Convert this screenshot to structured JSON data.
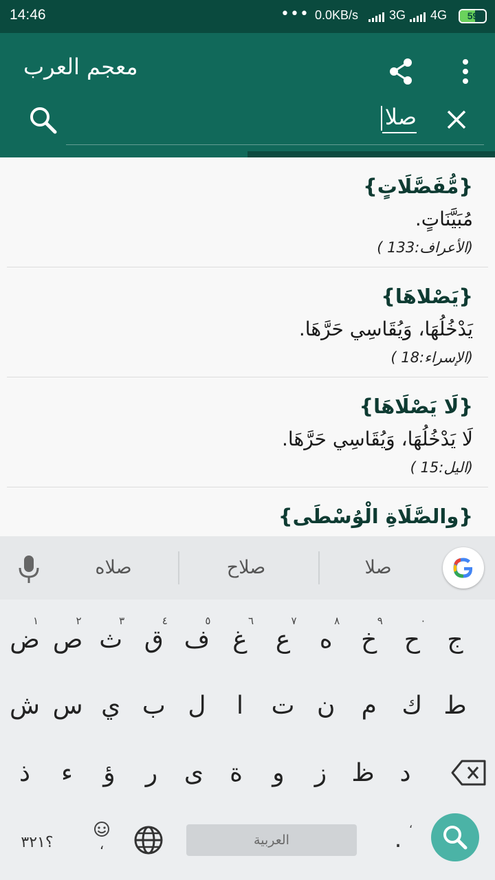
{
  "status_bar": {
    "time": "14:46",
    "dots": "•••",
    "net_speed": "0.0KB/s",
    "network_1": "3G",
    "network_2": "4G",
    "battery": "59",
    "battery_level": 0.59,
    "signal_bars_1": 5,
    "signal_bars_2": 5
  },
  "app_bar": {
    "title": "معجم العرب",
    "search_value": "صلا",
    "icons": [
      "share-icon",
      "more-vert-icon",
      "search-icon",
      "close-icon"
    ]
  },
  "load_progress": 0.5,
  "results": [
    {
      "head": "{مُّفَصَّلَاتٍ}",
      "definition": "مُبَيَّنَاتٍ.",
      "reference": "(الأعراف:133 )"
    },
    {
      "head": "{يَصْلاهَا}",
      "definition": "يَدْخُلُهَا، وَيُقَاسِي حَرَّهَا.",
      "reference": "(الإسراء:18 )"
    },
    {
      "head": "{لَا يَصْلَاهَا}",
      "definition": "لَا يَدْخُلُهَا، وَيُقَاسِي حَرَّهَا.",
      "reference": "(اليل:15 )"
    },
    {
      "head": "{والصَّلَاةِ الْوُسْطَى}",
      "definition": "",
      "reference": ""
    }
  ],
  "suggestions": [
    "صلا",
    "صلاح",
    "صلاه"
  ],
  "keyboard": {
    "row1": [
      {
        "k": "ض",
        "h": "١"
      },
      {
        "k": "ص",
        "h": "٢"
      },
      {
        "k": "ث",
        "h": "٣"
      },
      {
        "k": "ق",
        "h": "٤"
      },
      {
        "k": "ف",
        "h": "٥"
      },
      {
        "k": "غ",
        "h": "٦"
      },
      {
        "k": "ع",
        "h": "٧"
      },
      {
        "k": "ه",
        "h": "٨"
      },
      {
        "k": "خ",
        "h": "٩"
      },
      {
        "k": "ح",
        "h": "٠"
      },
      {
        "k": "ج",
        "h": ""
      }
    ],
    "row2": [
      "ش",
      "س",
      "ي",
      "ب",
      "ل",
      "ا",
      "ت",
      "ن",
      "م",
      "ك",
      "ط"
    ],
    "row3": [
      "ذ",
      "ء",
      "ؤ",
      "ر",
      "ى",
      "ة",
      "و",
      "ز",
      "ظ",
      "د"
    ],
    "symbols_label": "؟٣٢١",
    "space_label": "العربية",
    "period_label": ".",
    "period_hint": "،",
    "emoji_hint": "،",
    "accent_color": "#4bb3a6"
  },
  "colors": {
    "status_bar": "#0a4a3e",
    "app_bar": "#11695a",
    "result_head": "#0e3b32"
  }
}
